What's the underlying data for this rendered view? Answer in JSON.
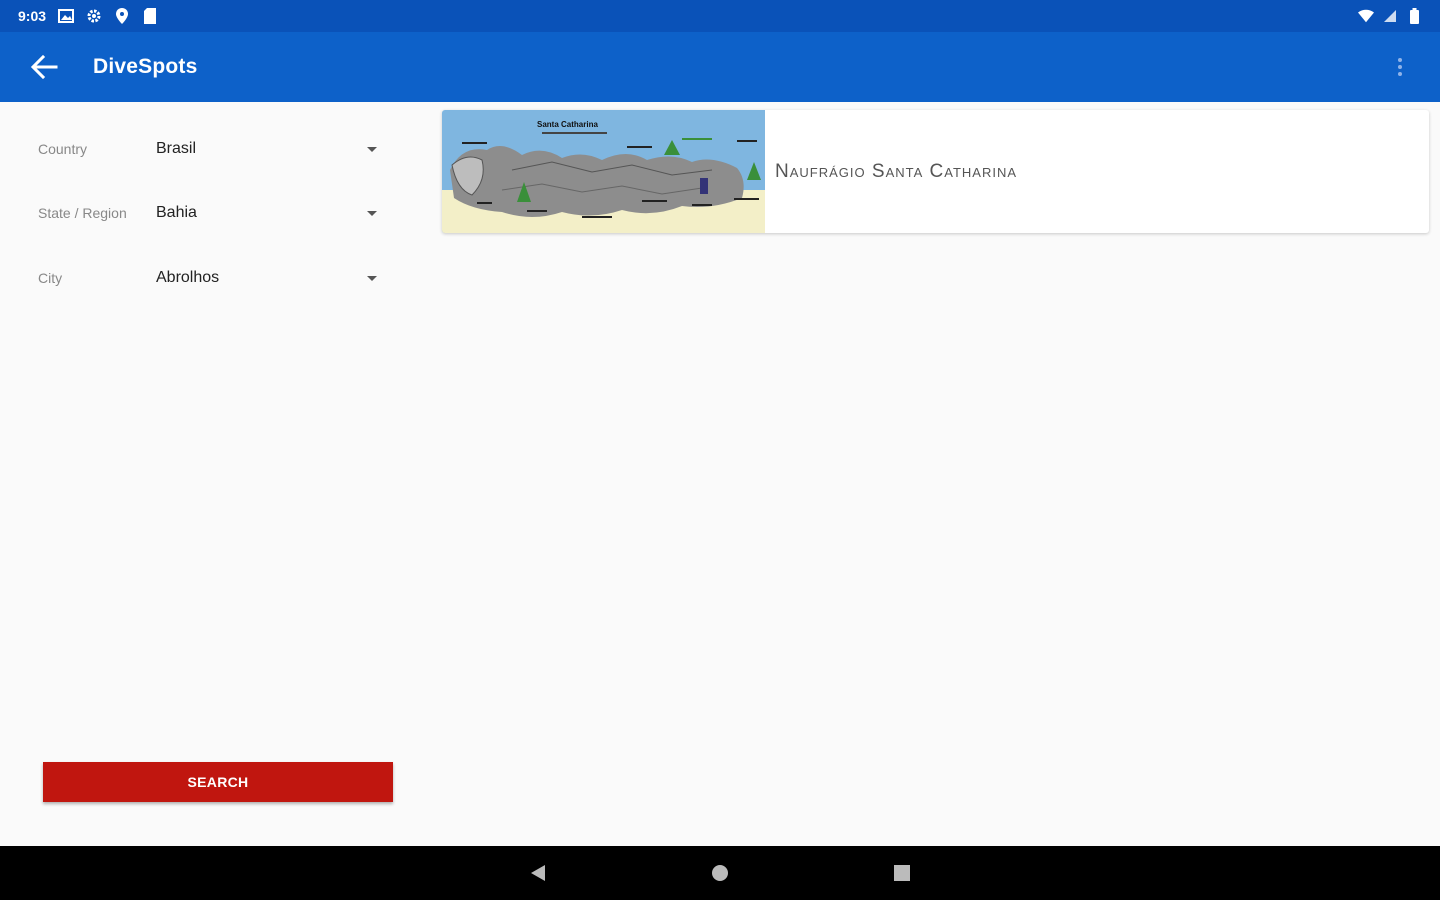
{
  "status_bar": {
    "time": "9:03"
  },
  "app_bar": {
    "title": "DiveSpots"
  },
  "filters": [
    {
      "label": "Country",
      "value": "Brasil"
    },
    {
      "label": "State / Region",
      "value": "Bahia"
    },
    {
      "label": "City",
      "value": "Abrolhos"
    }
  ],
  "search_button": {
    "label": "SEARCH"
  },
  "results": [
    {
      "title": "Naufrágio Santa Catharina",
      "thumb_caption": "Santa Catharina"
    }
  ],
  "colors": {
    "status_bar": "#0a52b8",
    "app_bar": "#0d61c9",
    "search_button": "#c0160f"
  },
  "icons": {
    "status": [
      "image-icon",
      "gear-icon",
      "location-icon",
      "sd-card-icon",
      "wifi-icon",
      "signal-icon",
      "battery-icon"
    ],
    "nav": [
      "back-triangle-icon",
      "home-circle-icon",
      "recents-square-icon"
    ]
  }
}
